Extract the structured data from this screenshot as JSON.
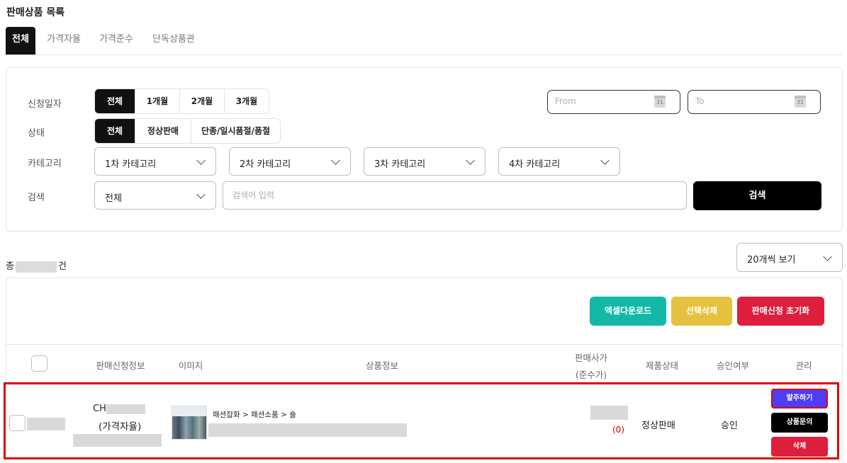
{
  "page": {
    "title": "판매상품 목록"
  },
  "tabs": [
    {
      "label": "전체",
      "active": true
    },
    {
      "label": "가격자율"
    },
    {
      "label": "가격준수"
    },
    {
      "label": "단독상품관"
    }
  ],
  "filters": {
    "date": {
      "label": "신청일자",
      "options": [
        "전체",
        "1개월",
        "2개월",
        "3개월"
      ],
      "selected": "전체",
      "from_placeholder": "From",
      "to_placeholder": "To",
      "calendar_day": "31"
    },
    "status": {
      "label": "상태",
      "options": [
        "전체",
        "정상판매",
        "단종/일시품절/품절"
      ],
      "selected": "전체"
    },
    "category": {
      "label": "카테고리",
      "selects": [
        "1차 카테고리",
        "2차 카테고리",
        "3차 카테고리",
        "4차 카테고리"
      ]
    },
    "search": {
      "label": "검색",
      "field": "전체",
      "placeholder": "검색어 입력",
      "button": "검색"
    }
  },
  "summary": {
    "prefix": "총",
    "suffix": "건"
  },
  "per_page": "20개씩 보기",
  "actions": {
    "excel": "엑셀다운로드",
    "delete_selected": "선택삭제",
    "reset": "판매신청 초기화"
  },
  "table": {
    "headers": {
      "info": "판매신청정보",
      "image": "이미지",
      "product": "상품정보",
      "price_line1": "판매사가",
      "price_line2": "(준수가)",
      "condition": "제품상태",
      "approval": "승인여부",
      "manage": "관리"
    },
    "rows": [
      {
        "code_prefix": "CH",
        "price_type": "(가격자율)",
        "category_path": "패션잡화 > 패션소품 > 숄",
        "compliance_price": "(0)",
        "condition": "정상판매",
        "approval": "승인",
        "buttons": {
          "order": "발주하기",
          "inquiry": "상품문의",
          "delete": "삭제"
        }
      }
    ]
  },
  "colors": {
    "excel": "#14b8a6",
    "delete_selected": "#e6c13f",
    "reset": "#dc1f3c",
    "order": "#4f3cf7",
    "highlight": "#e00000"
  }
}
